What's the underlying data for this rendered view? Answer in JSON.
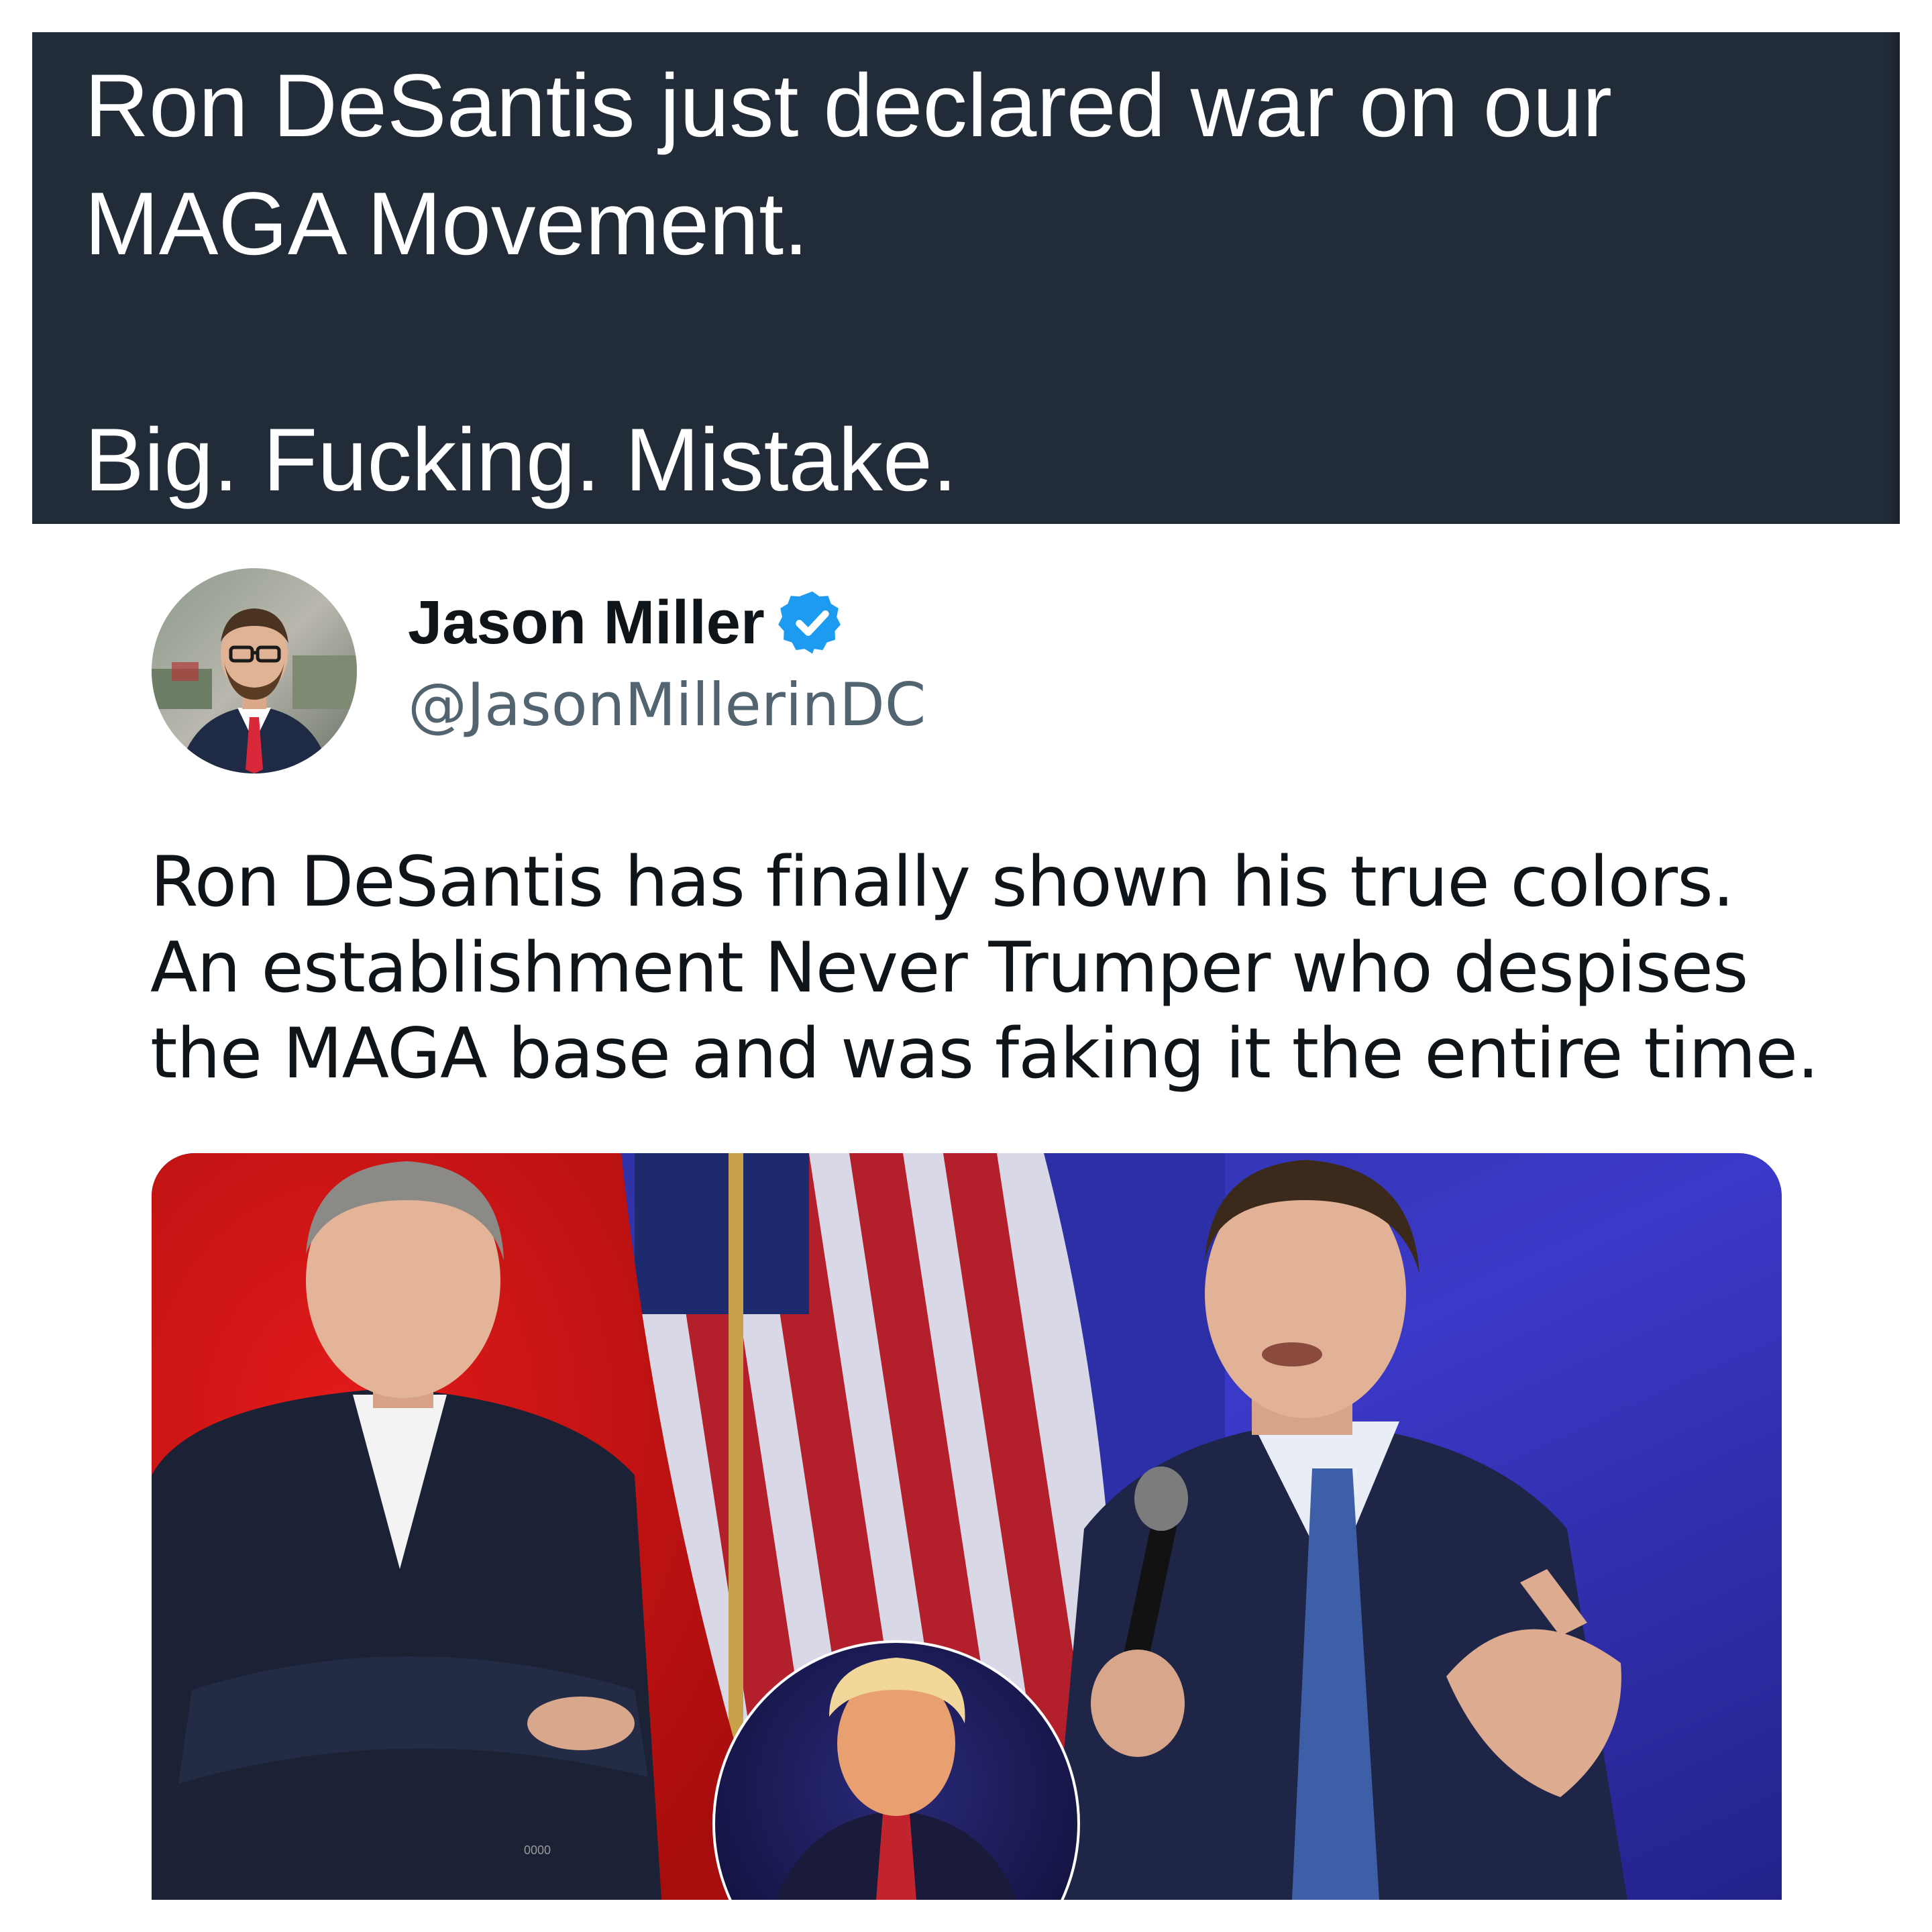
{
  "quote_post": {
    "lines": [
      "Ron DeSantis just declared war on our",
      "MAGA Movement.",
      "",
      "Big. Fucking. Mistake."
    ]
  },
  "embedded_tweet": {
    "author": {
      "display_name": "Jason Miller",
      "handle": "@JasonMillerinDC",
      "verified": true,
      "avatar_icon": "profile-photo"
    },
    "body_lines": [
      "Ron DeSantis has finally shown his true colors.",
      "An establishment Never Trumper who despises",
      "the MAGA base and was faking it the entire time."
    ],
    "media": {
      "type": "photo-collage",
      "jacket_button_text": "0000"
    }
  },
  "colors": {
    "dark_panel": "#222b38",
    "verified_blue": "#1d9bf0",
    "handle_gray": "#536471",
    "text_primary": "#0f1419"
  }
}
